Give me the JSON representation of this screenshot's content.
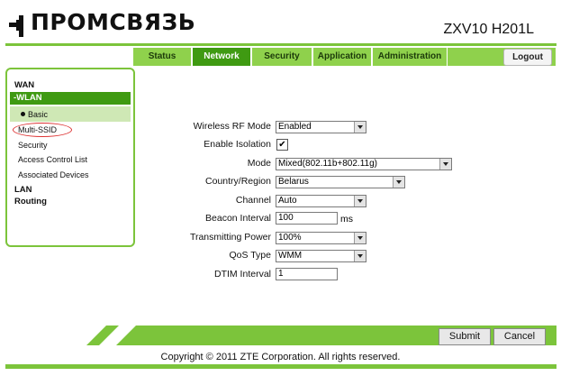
{
  "brand": {
    "name": "ПРОМСВЯЗЬ",
    "model": "ZXV10 H201L"
  },
  "nav": {
    "tabs": [
      "Status",
      "Network",
      "Security",
      "Application",
      "Administration"
    ],
    "active": "Network",
    "logout_label": "Logout"
  },
  "sidebar": {
    "wan": "WAN",
    "wlan": "-WLAN",
    "items": [
      "Basic",
      "Multi-SSID",
      "Security",
      "Access Control List",
      "Associated Devices"
    ],
    "lan": "LAN",
    "routing": "Routing"
  },
  "form": {
    "rf_mode": {
      "label": "Wireless RF Mode",
      "value": "Enabled"
    },
    "isolation": {
      "label": "Enable Isolation",
      "checked": "✔"
    },
    "mode": {
      "label": "Mode",
      "value": "Mixed(802.11b+802.11g)"
    },
    "country": {
      "label": "Country/Region",
      "value": "Belarus"
    },
    "channel": {
      "label": "Channel",
      "value": "Auto"
    },
    "beacon": {
      "label": "Beacon Interval",
      "value": "100",
      "unit": "ms"
    },
    "power": {
      "label": "Transmitting Power",
      "value": "100%"
    },
    "qos": {
      "label": "QoS Type",
      "value": "WMM"
    },
    "dtim": {
      "label": "DTIM Interval",
      "value": "1"
    }
  },
  "actions": {
    "submit": "Submit",
    "cancel": "Cancel"
  },
  "footer": {
    "copyright": "Copyright © 2011 ZTE Corporation. All rights reserved."
  },
  "colors": {
    "accent": "#7cc43b",
    "active_tab": "#3f9a12",
    "tab": "#8fd14c"
  }
}
